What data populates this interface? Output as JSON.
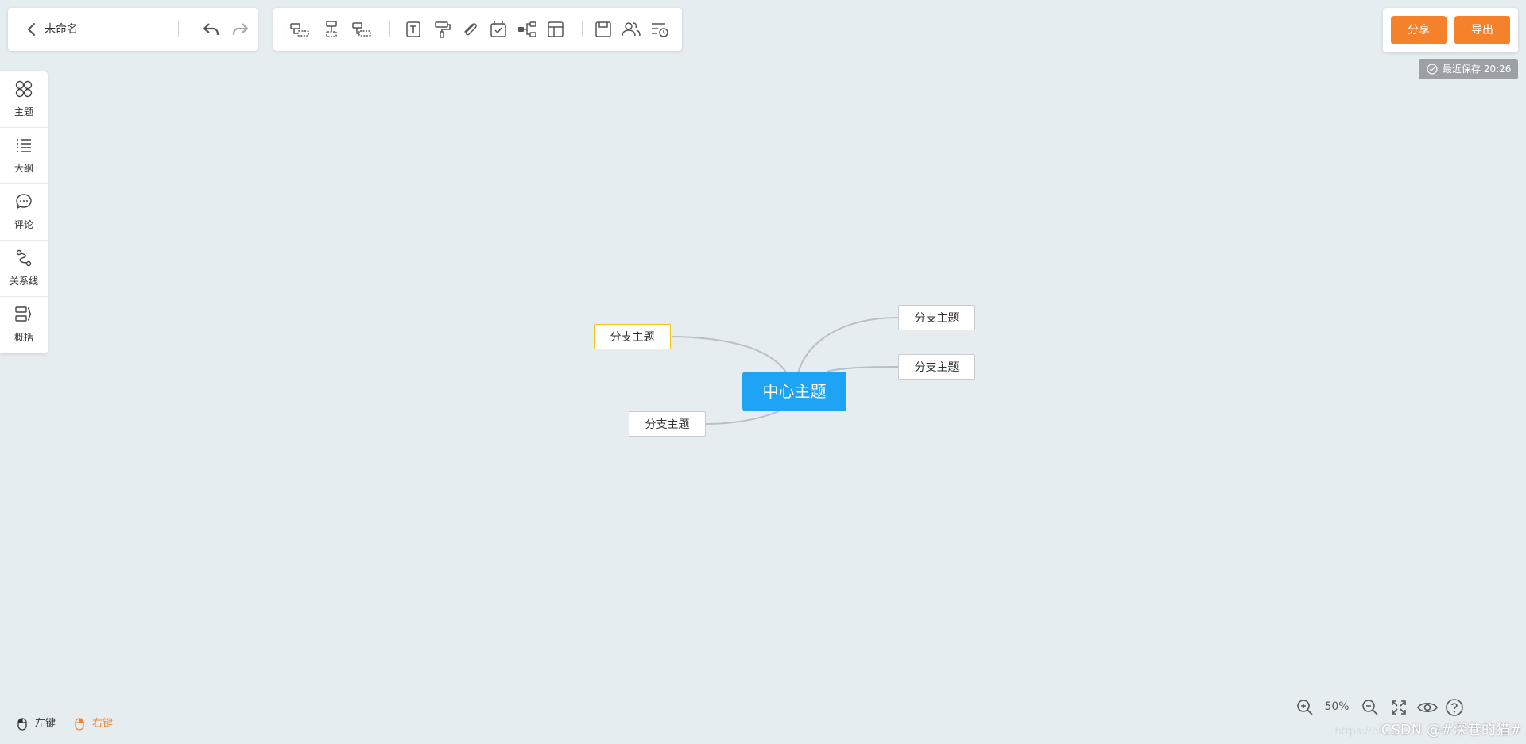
{
  "app": {
    "doc_title": "未命名"
  },
  "toolbar": {
    "items": [
      "insert-sibling-icon",
      "insert-child-icon",
      "insert-parent-icon",
      "text-icon",
      "format-painter-icon",
      "attachment-icon",
      "task-icon",
      "structure-icon",
      "layout-icon",
      "save-icon",
      "collaborate-icon",
      "history-icon"
    ]
  },
  "actions": {
    "share_label": "分享",
    "export_label": "导出",
    "save_status": "最近保存 20:26"
  },
  "sidebar": {
    "items": [
      {
        "label": "主题",
        "icon": "theme-icon"
      },
      {
        "label": "大纲",
        "icon": "outline-icon"
      },
      {
        "label": "评论",
        "icon": "comment-icon"
      },
      {
        "label": "关系线",
        "icon": "relation-line-icon"
      },
      {
        "label": "概括",
        "icon": "summary-icon"
      }
    ]
  },
  "mindmap": {
    "center": "中心主题",
    "branches": [
      {
        "label": "分支主题",
        "side": "left",
        "selected": true
      },
      {
        "label": "分支主题",
        "side": "left",
        "selected": false
      },
      {
        "label": "分支主题",
        "side": "right",
        "selected": false
      },
      {
        "label": "分支主题",
        "side": "right",
        "selected": false
      }
    ]
  },
  "hints": {
    "left_click": "左键",
    "right_click": "右键"
  },
  "zoom": {
    "level": "50%"
  },
  "watermark": {
    "faint": "https://bl",
    "text": "CSDN @#深巷的猫#"
  },
  "colors": {
    "accent": "#f5822a",
    "center_node": "#1ea3f5",
    "selected_border": "#f5c518",
    "canvas": "#e6edf1"
  }
}
